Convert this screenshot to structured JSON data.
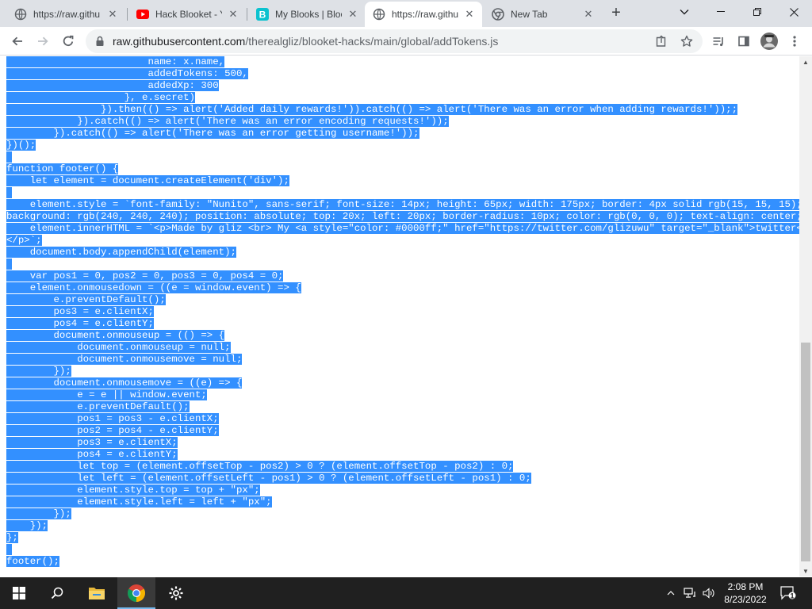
{
  "browser": {
    "tabs": [
      {
        "title": "https://raw.githu",
        "icon": "github-icon",
        "active": false
      },
      {
        "title": "Hack Blooket - Yo",
        "icon": "youtube-icon",
        "active": false
      },
      {
        "title": "My Blooks | Bloo",
        "icon": "blooket-icon",
        "active": false
      },
      {
        "title": "https://raw.githu",
        "icon": "github-icon",
        "active": true
      },
      {
        "title": "New Tab",
        "icon": "chrome-icon",
        "active": false
      }
    ],
    "new_tab_label": "+",
    "url_host": "raw.githubusercontent.com",
    "url_path": "/therealgliz/blooket-hacks/main/global/addTokens.js"
  },
  "code_lines": [
    "                        name: x.name,",
    "                        addedTokens: 500,",
    "                        addedXp: 300",
    "                    }, e.secret)",
    "                }).then(() => alert('Added daily rewards!')).catch(() => alert('There was an error when adding rewards!'));;",
    "            }).catch(() => alert('There was an error encoding requests!'));",
    "        }).catch(() => alert('There was an error getting username!'));",
    "})();",
    "",
    "function footer() {",
    "    let element = document.createElement('div');",
    "",
    "    element.style = `font-family: \"Nunito\", sans-serif; font-size: 14px; height: 65px; width: 175px; border: 4px solid rgb(15, 15, 15);",
    "background: rgb(240, 240, 240); position: absolute; top: 20x; left: 20px; border-radius: 10px; color: rgb(0, 0, 0); text-align: center;`;",
    "    element.innerHTML = `<p>Made by gliz <br> My <a style=\"color: #0000ff;\" href=\"https://twitter.com/glizuwu\" target=\"_blank\">twitter</a>",
    "</p>`;",
    "    document.body.appendChild(element);",
    "",
    "    var pos1 = 0, pos2 = 0, pos3 = 0, pos4 = 0;",
    "    element.onmousedown = ((e = window.event) => {",
    "        e.preventDefault();",
    "        pos3 = e.clientX;",
    "        pos4 = e.clientY;",
    "        document.onmouseup = (() => {",
    "            document.onmouseup = null;",
    "            document.onmousemove = null;",
    "        });",
    "        document.onmousemove = ((e) => {",
    "            e = e || window.event;",
    "            e.preventDefault();",
    "            pos1 = pos3 - e.clientX;",
    "            pos2 = pos4 - e.clientY;",
    "            pos3 = e.clientX;",
    "            pos4 = e.clientY;",
    "            let top = (element.offsetTop - pos2) > 0 ? (element.offsetTop - pos2) : 0;",
    "            let left = (element.offsetLeft - pos1) > 0 ? (element.offsetLeft - pos1) : 0;",
    "            element.style.top = top + \"px\";",
    "            element.style.left = left + \"px\";",
    "        });",
    "    });",
    "};",
    "",
    "footer();"
  ],
  "taskbar": {
    "apps": [
      "start-icon",
      "search-icon",
      "file-explorer-icon",
      "chrome-icon",
      "settings-icon"
    ],
    "time": "2:08 PM",
    "date": "8/23/2022",
    "notification_count": "1"
  },
  "colors": {
    "selection": "#3390ff",
    "tabstrip": "#dee1e6",
    "taskbar": "#202020"
  }
}
